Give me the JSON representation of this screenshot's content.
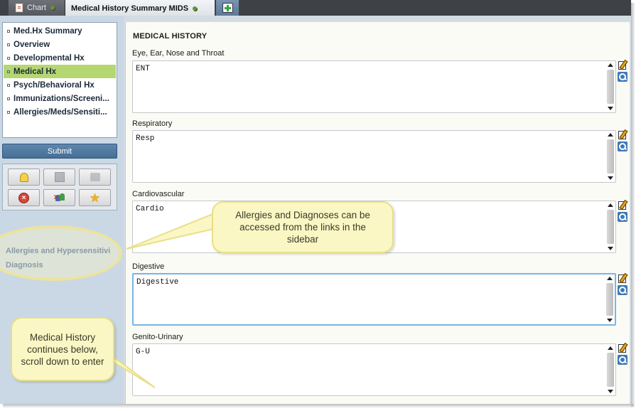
{
  "tabs": [
    {
      "label": "Chart",
      "icon": "document-icon"
    },
    {
      "label": "Medical History Summary MIDS",
      "icon": "pin-icon"
    },
    {
      "label": "",
      "icon": "add-tab-icon"
    }
  ],
  "sidebar": {
    "items": [
      {
        "label": "Med.Hx Summary"
      },
      {
        "label": "Overview"
      },
      {
        "label": "Developmental Hx"
      },
      {
        "label": "Medical Hx",
        "active": true
      },
      {
        "label": "Psych/Behavioral Hx"
      },
      {
        "label": "Immunizations/Screeni..."
      },
      {
        "label": "Allergies/Meds/Sensiti..."
      }
    ],
    "submit_label": "Submit",
    "toolbar_icons": [
      "lightbulb-icon",
      "floppy-icon",
      "note-icon",
      "cancel-icon",
      "people-icon",
      "star-icon"
    ],
    "links": {
      "allergies": "Allergies and Hypersensitivi",
      "diagnosis": "Diagnosis"
    }
  },
  "main": {
    "section_title": "MEDICAL HISTORY",
    "fields": [
      {
        "label": "Eye, Ear, Nose and Throat",
        "value": "ENT"
      },
      {
        "label": "Respiratory",
        "value": "Resp"
      },
      {
        "label": "Cardiovascular",
        "value": "Cardio"
      },
      {
        "label": "Digestive",
        "value": "Digestive",
        "focused": true
      },
      {
        "label": "Genito-Urinary",
        "value": "G-U"
      }
    ]
  },
  "callouts": {
    "sidebar_links": "Allergies and Diagnoses can be accessed from the links in the sidebar",
    "scroll": "Medical History continues below, scroll down to enter"
  },
  "colors": {
    "active_nav": "#b4d771",
    "submit_button": "#466f96",
    "callout_bg": "#fbf7c4",
    "focus_border": "#79b6e2"
  }
}
